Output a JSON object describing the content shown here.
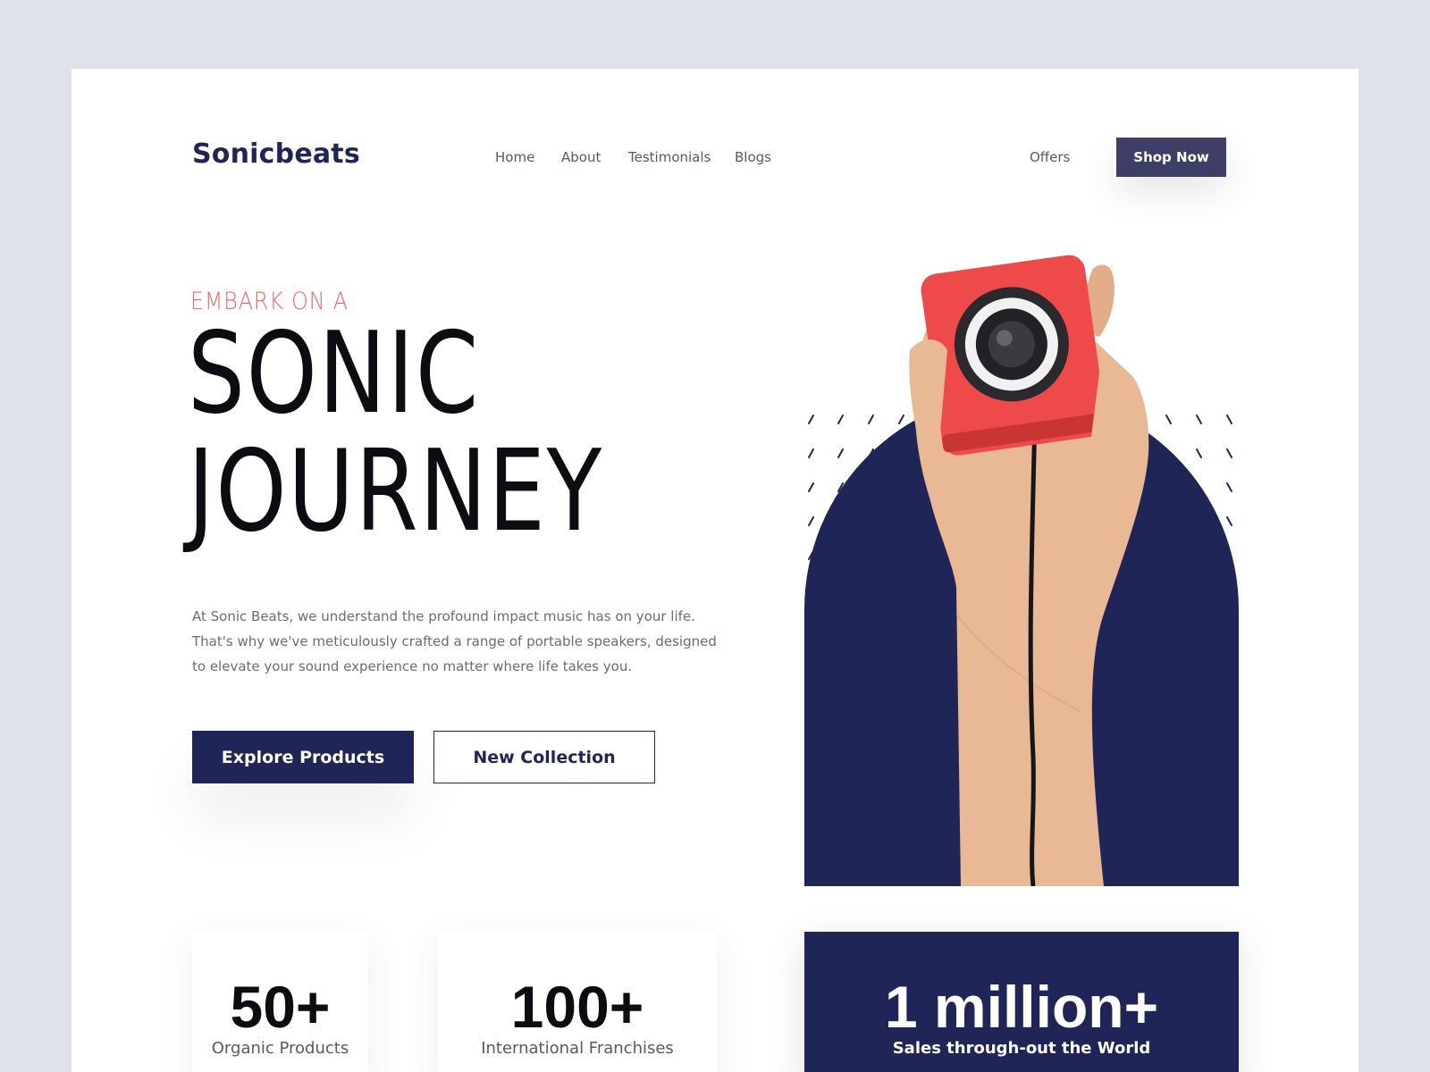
{
  "brand": {
    "name": "Sonicbeats"
  },
  "nav": {
    "items": [
      "Home",
      "About",
      "Testimonials",
      "Blogs"
    ],
    "offers": "Offers",
    "shop_now": "Shop Now"
  },
  "hero": {
    "eyebrow": "EMBARK ON A",
    "headline_line1": "SONIC",
    "headline_line2": "JOURNEY",
    "description": "At Sonic Beats, we understand the profound impact music has on your life. That's why we've meticulously crafted a range of portable speakers, designed to elevate your sound experience no matter where life takes you.",
    "explore_label": "Explore Products",
    "collection_label": "New Collection",
    "image_subject": "hand-holding-red-speaker"
  },
  "stats": [
    {
      "value": "50+",
      "label": "Organic Products"
    },
    {
      "value": "100+",
      "label": "International Franchises"
    },
    {
      "value": "1 million+",
      "label": "Sales through-out the World"
    }
  ],
  "colors": {
    "background": "#dfe2ea",
    "navy": "#1f2657",
    "accent": "#e8696c",
    "shop_button": "#3d3f67",
    "speaker_red": "#ee4a4a"
  }
}
